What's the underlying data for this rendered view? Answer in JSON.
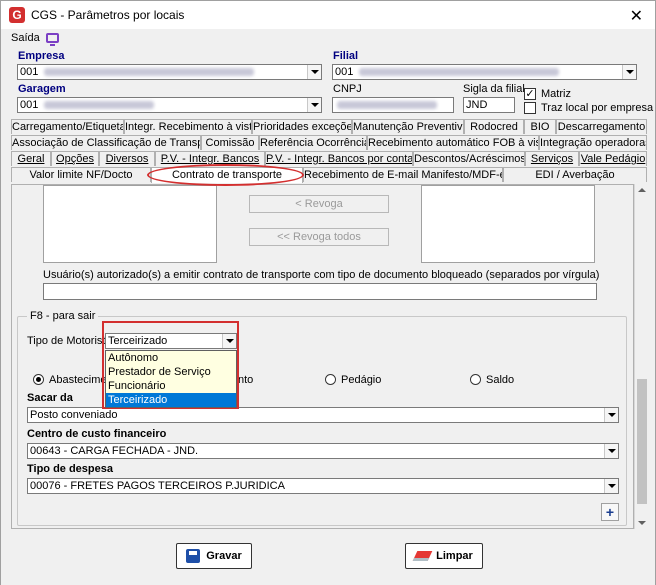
{
  "window": {
    "title": "CGS - Parâmetros por locais",
    "app_icon_letter": "G",
    "close_glyph": "✕"
  },
  "menu": {
    "exit_label": "Saída"
  },
  "header": {
    "empresa_label": "Empresa",
    "empresa_code": "001",
    "filial_label": "Filial",
    "filial_code": "001",
    "garagem_label": "Garagem",
    "garagem_code": "001",
    "cnpj_label": "CNPJ",
    "sigla_label": "Sigla da filial",
    "sigla_value": "JND",
    "matriz_label": "Matriz",
    "matriz_checked": true,
    "traz_local_label": "Traz local por empresa",
    "traz_local_checked": false
  },
  "tabs": {
    "row1": [
      "Carregamento/Etiquetas",
      "Integr. Recebimento à vista",
      "Prioridades exceções",
      "Manutenção Preventiva",
      "Rodocred",
      "BIO",
      "Descarregamento"
    ],
    "row2": [
      "Associação de Classificação de Transporte",
      "Comissão",
      "Referência Ocorrência",
      "Recebimento automático FOB à vista",
      "Integração operadoras"
    ],
    "row3": [
      "Geral",
      "Opções",
      "Diversos",
      "P.V. - Integr. Bancos",
      "P.V. - Integr. Bancos por conta",
      "Descontos/Acréscimos",
      "Serviços",
      "Vale Pedágio"
    ],
    "row4": [
      "Valor limite NF/Docto",
      "Contrato de transporte",
      "Recebimento de E-mail Manifesto/MDF-e",
      "EDI / Averbação"
    ],
    "active": "Contrato de transporte"
  },
  "contrato": {
    "revoga_label": "< Revoga",
    "revoga_todos_label": "<< Revoga todos",
    "usuarios_label": "Usuário(s) autorizado(s) a emitir contrato de transporte com tipo de documento bloqueado (separados por vírgula)",
    "usuarios_value": ""
  },
  "f8_section": {
    "legend": "F8 - para sair",
    "tipo_motorista_label": "Tipo de Motorista",
    "tipo_motorista_value": "Terceirizado",
    "dropdown_options": [
      "Autônomo",
      "Prestador de Serviço",
      "Funcionário",
      "Terceirizado"
    ],
    "dropdown_selected_index": 3,
    "radio_options": [
      {
        "label": "Abastecimento",
        "checked": true
      },
      {
        "label": "Pedágio",
        "checked": false
      },
      {
        "label": "Saldo",
        "checked": false
      }
    ],
    "radio_partial_text": "nto",
    "sacar_da_label": "Sacar da",
    "sacar_da_value": "Posto conveniado",
    "centro_custo_label": "Centro de custo financeiro",
    "centro_custo_value": "00643 - CARGA FECHADA - JND.",
    "tipo_despesa_label": "Tipo de despesa",
    "tipo_despesa_value": "00076 - FRETES PAGOS TERCEIROS P.JURIDICA",
    "plus_glyph": "+"
  },
  "footer": {
    "gravar_label": "Gravar",
    "limpar_label": "Limpar"
  },
  "colors": {
    "accent_red": "#d32f2f",
    "label_blue": "#000080",
    "selection_blue": "#0078d7",
    "dropdown_bg": "#ffffe1"
  }
}
